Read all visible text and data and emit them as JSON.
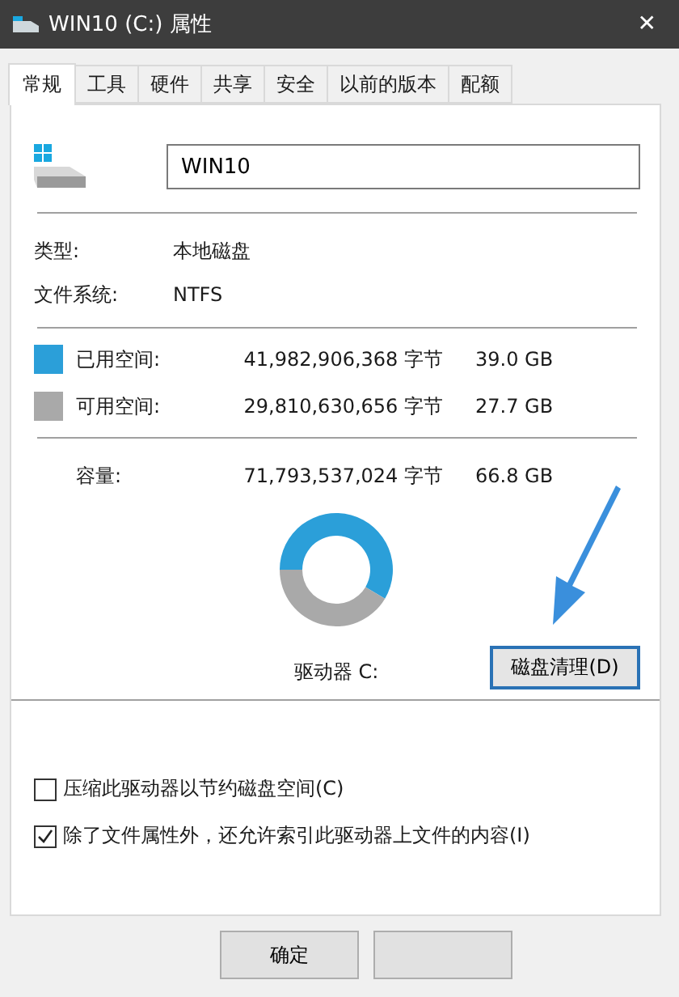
{
  "window": {
    "title": "WIN10 (C:) 属性",
    "close": "✕"
  },
  "tabs": [
    {
      "label": "常规",
      "selected": true
    },
    {
      "label": "工具",
      "selected": false
    },
    {
      "label": "硬件",
      "selected": false
    },
    {
      "label": "共享",
      "selected": false
    },
    {
      "label": "安全",
      "selected": false
    },
    {
      "label": "以前的版本",
      "selected": false
    },
    {
      "label": "配额",
      "selected": false
    }
  ],
  "drive_name": {
    "value": "WIN10"
  },
  "info": [
    {
      "label": "类型:",
      "value": "本地磁盘"
    },
    {
      "label": "文件系统:",
      "value": "NTFS"
    }
  ],
  "space": [
    {
      "label": "已用空间:",
      "bytes": "41,982,906,368 字节",
      "size": "39.0 GB",
      "color": "#2b9fd9"
    },
    {
      "label": "可用空间:",
      "bytes": "29,810,630,656 字节",
      "size": "27.7 GB",
      "color": "#a9a9a9"
    }
  ],
  "capacity": {
    "label": "容量:",
    "bytes": "71,793,537,024 字节",
    "size": "66.8 GB"
  },
  "usage_ring": {
    "chart_data": {
      "type": "donut",
      "values": [
        58.5,
        41.5
      ]
    }
  },
  "drive_label": "驱动器 C:",
  "cleanup_button": "磁盘清理(D)",
  "options": [
    {
      "label": "压缩此驱动器以节约磁盘空间(C)",
      "checked": false
    },
    {
      "label": "除了文件属性外，还允许索引此驱动器上文件的内容(I)",
      "checked": true
    }
  ],
  "buttons": [
    {
      "kind": "text",
      "label": "确定"
    },
    {
      "kind": "blank"
    }
  ]
}
